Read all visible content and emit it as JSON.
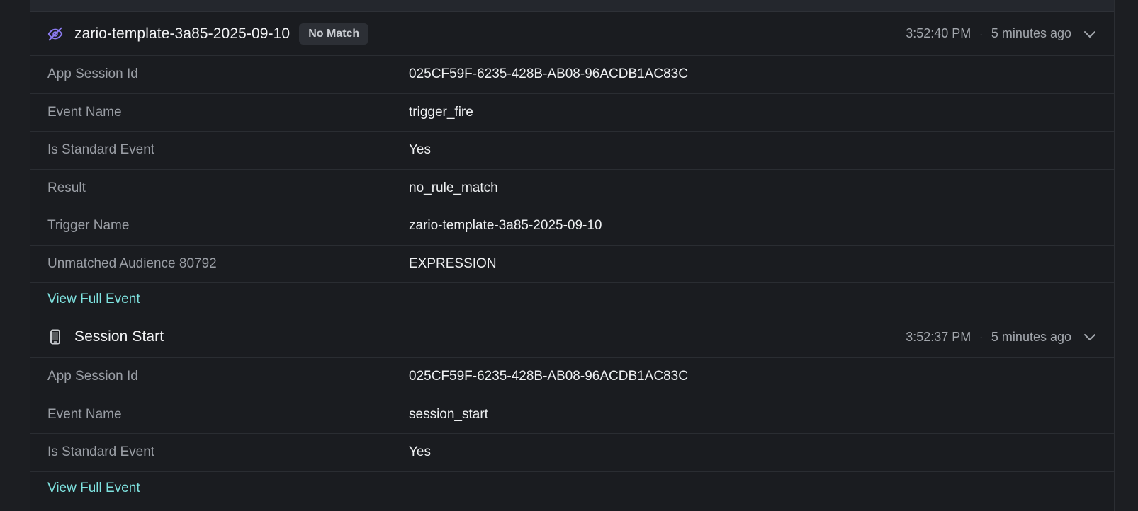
{
  "events": [
    {
      "icon": "eye-slash-icon",
      "title": "zario-template-3a85-2025-09-10",
      "badge": "No Match",
      "time": "3:52:40 PM",
      "separator": "·",
      "relative": "5 minutes ago",
      "rows": [
        {
          "key": "App Session Id",
          "value": "025CF59F-6235-428B-AB08-96ACDB1AC83C"
        },
        {
          "key": "Event Name",
          "value": "trigger_fire"
        },
        {
          "key": "Is Standard Event",
          "value": "Yes"
        },
        {
          "key": "Result",
          "value": "no_rule_match"
        },
        {
          "key": "Trigger Name",
          "value": "zario-template-3a85-2025-09-10"
        },
        {
          "key": "Unmatched Audience 80792",
          "value": "EXPRESSION"
        }
      ],
      "link": "View Full Event"
    },
    {
      "icon": "mobile-device-icon",
      "title": "Session Start",
      "time": "3:52:37 PM",
      "separator": "·",
      "relative": "5 minutes ago",
      "rows": [
        {
          "key": "App Session Id",
          "value": "025CF59F-6235-428B-AB08-96ACDB1AC83C"
        },
        {
          "key": "Event Name",
          "value": "session_start"
        },
        {
          "key": "Is Standard Event",
          "value": "Yes"
        }
      ],
      "link": "View Full Event"
    }
  ],
  "colors": {
    "accent_link": "#7fe3e0",
    "icon_purple": "#8b7bf0",
    "background": "#1a1c20"
  }
}
